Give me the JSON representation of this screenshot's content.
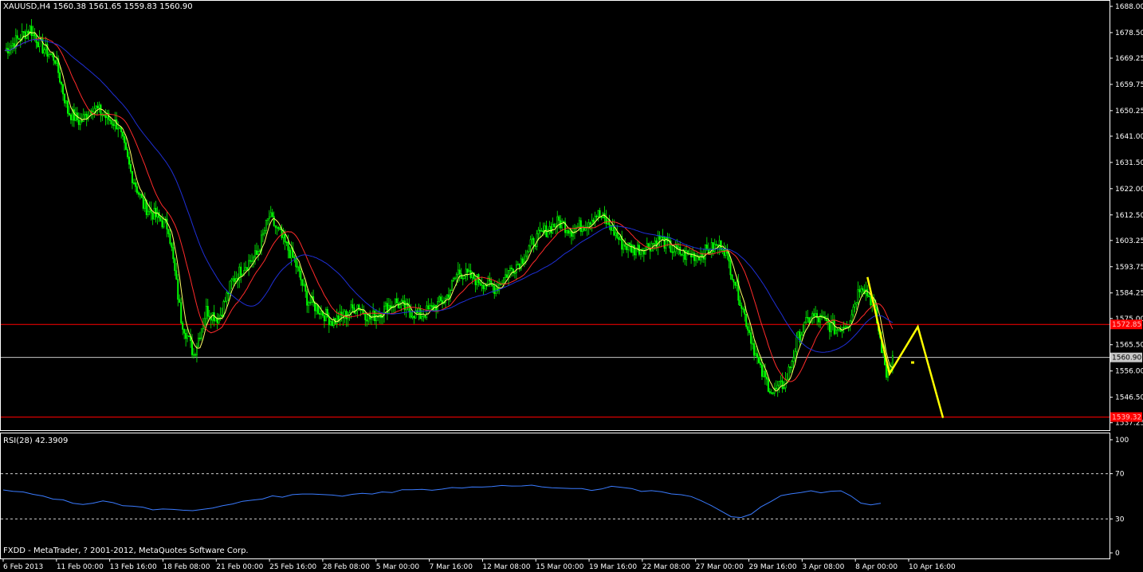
{
  "window": {
    "symbol_header": "XAUUSD,H4  1560.38 1561.65 1559.83 1560.90",
    "copyright": "FXDD - MetaTrader, ? 2001-2012, MetaQuotes Software Corp."
  },
  "colors": {
    "background": "#000000",
    "grid_frame": "#ffffff",
    "candles": "#00ff00",
    "ma_fast": "#ffff66",
    "ma_mid": "#ff2a2a",
    "ma_slow": "#1f2fd6",
    "rsi_line": "#3a7bff",
    "hline_red": "#ff0000",
    "hline_price": "#c8c8c8",
    "projection": "#ffff00"
  },
  "chart_data": [
    {
      "type": "candlestick",
      "title": "XAUUSD,H4",
      "ohlc_last": {
        "open": 1560.38,
        "high": 1561.65,
        "low": 1559.83,
        "close": 1560.9
      },
      "price_axis_ticks": [
        "1688.00",
        "1678.50",
        "1669.25",
        "1659.75",
        "1650.25",
        "1641.00",
        "1631.50",
        "1622.00",
        "1612.50",
        "1603.25",
        "1593.75",
        "1584.25",
        "1575.00",
        "1565.50",
        "1556.00",
        "1546.50",
        "1537.25"
      ],
      "ylim": [
        1536.0,
        1688.0
      ],
      "time_axis_labels": [
        "6 Feb 2013",
        "11 Feb 00:00",
        "13 Feb 16:00",
        "18 Feb 08:00",
        "21 Feb 00:00",
        "25 Feb 16:00",
        "28 Feb 08:00",
        "5 Mar 00:00",
        "7 Mar 16:00",
        "12 Mar 08:00",
        "15 Mar 00:00",
        "19 Mar 16:00",
        "22 Mar 08:00",
        "27 Mar 00:00",
        "29 Mar 16:00",
        "3 Apr 08:00",
        "8 Apr 00:00",
        "10 Apr 16:00"
      ],
      "price_points": [
        [
          0,
          1672
        ],
        [
          2,
          1676
        ],
        [
          4,
          1680
        ],
        [
          6,
          1673
        ],
        [
          8,
          1669
        ],
        [
          10,
          1650
        ],
        [
          12,
          1646
        ],
        [
          14,
          1652
        ],
        [
          16,
          1648
        ],
        [
          18,
          1645
        ],
        [
          20,
          1628
        ],
        [
          22,
          1616
        ],
        [
          24,
          1612
        ],
        [
          26,
          1608
        ],
        [
          28,
          1575
        ],
        [
          30,
          1562
        ],
        [
          32,
          1578
        ],
        [
          34,
          1575
        ],
        [
          36,
          1588
        ],
        [
          38,
          1594
        ],
        [
          40,
          1598
        ],
        [
          42,
          1612
        ],
        [
          44,
          1604
        ],
        [
          46,
          1596
        ],
        [
          48,
          1582
        ],
        [
          50,
          1578
        ],
        [
          52,
          1574
        ],
        [
          54,
          1576
        ],
        [
          56,
          1580
        ],
        [
          58,
          1575
        ],
        [
          60,
          1578
        ],
        [
          62,
          1581
        ],
        [
          64,
          1578
        ],
        [
          66,
          1576
        ],
        [
          68,
          1579
        ],
        [
          70,
          1582
        ],
        [
          72,
          1592
        ],
        [
          74,
          1590
        ],
        [
          76,
          1588
        ],
        [
          78,
          1586
        ],
        [
          80,
          1592
        ],
        [
          82,
          1596
        ],
        [
          84,
          1603
        ],
        [
          86,
          1607
        ],
        [
          88,
          1610
        ],
        [
          90,
          1607
        ],
        [
          92,
          1609
        ],
        [
          94,
          1613
        ],
        [
          96,
          1609
        ],
        [
          98,
          1602
        ],
        [
          100,
          1600
        ],
        [
          102,
          1601
        ],
        [
          104,
          1604
        ],
        [
          106,
          1600
        ],
        [
          108,
          1598
        ],
        [
          110,
          1598
        ],
        [
          112,
          1600
        ],
        [
          114,
          1602
        ],
        [
          116,
          1588
        ],
        [
          118,
          1572
        ],
        [
          120,
          1556
        ],
        [
          122,
          1548
        ],
        [
          124,
          1552
        ],
        [
          126,
          1568
        ],
        [
          128,
          1576
        ],
        [
          130,
          1574
        ],
        [
          132,
          1571
        ],
        [
          134,
          1574
        ],
        [
          136,
          1588
        ],
        [
          138,
          1580
        ],
        [
          140,
          1555
        ],
        [
          141,
          1560.9
        ]
      ],
      "bars_count": 141,
      "horizontal_levels": [
        {
          "price": 1572.85,
          "label": "1572.85",
          "color": "#ff0000"
        },
        {
          "price": 1560.9,
          "label": "1560.90",
          "color": "#c8c8c8"
        },
        {
          "price": 1539.32,
          "label": "1539.32",
          "color": "#ff0000"
        }
      ],
      "projection": [
        {
          "bar": 137,
          "price": 1590
        },
        {
          "bar": 140.5,
          "price": 1555
        },
        {
          "bar": 145,
          "price": 1572
        },
        {
          "bar": 149,
          "price": 1539
        }
      ],
      "grid": false
    },
    {
      "type": "line",
      "title": "RSI(28) 42.3909",
      "ylim": [
        0,
        100
      ],
      "levels": [
        30,
        70
      ],
      "axis_ticks": [
        "100",
        "70",
        "30",
        "0"
      ],
      "values": [
        56,
        55,
        53,
        52,
        50,
        48,
        46,
        44,
        43,
        44,
        45,
        44,
        42,
        41,
        40,
        39,
        38,
        38,
        37,
        38,
        39,
        40,
        41,
        43,
        45,
        47,
        48,
        50,
        50,
        51,
        52,
        52,
        52,
        51,
        51,
        52,
        53,
        53,
        54,
        54,
        55,
        55,
        56,
        56,
        57,
        57,
        58,
        58,
        58,
        59,
        59,
        60,
        60,
        59,
        58,
        57,
        57,
        56,
        56,
        56,
        57,
        58,
        57,
        56,
        55,
        55,
        54,
        53,
        52,
        50,
        47,
        42,
        36,
        32,
        31,
        34,
        40,
        46,
        50,
        52,
        53,
        54,
        54,
        55,
        55,
        50,
        44,
        42,
        43
      ]
    }
  ]
}
